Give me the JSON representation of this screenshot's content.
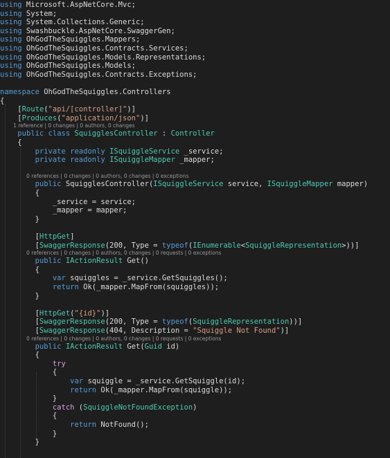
{
  "editor": {
    "theme_colors": {
      "background": "#1e1e1e",
      "text": "#dcdcdc",
      "keyword": "#569cd6",
      "type": "#4ec9b0",
      "string": "#d69d85",
      "control": "#d8a0df",
      "codelens": "#999999"
    },
    "lines": [
      {
        "kind": "code",
        "tokens": [
          {
            "t": "using",
            "c": "kw"
          },
          {
            "t": " Microsoft.AspNetCore.Mvc;",
            "c": "pl"
          }
        ]
      },
      {
        "kind": "code",
        "tokens": [
          {
            "t": "using",
            "c": "kw"
          },
          {
            "t": " System;",
            "c": "pl"
          }
        ]
      },
      {
        "kind": "code",
        "tokens": [
          {
            "t": "using",
            "c": "kw"
          },
          {
            "t": " System.Collections.Generic;",
            "c": "pl"
          }
        ]
      },
      {
        "kind": "code",
        "tokens": [
          {
            "t": "using",
            "c": "kw"
          },
          {
            "t": " Swashbuckle.AspNetCore.SwaggerGen;",
            "c": "pl"
          }
        ]
      },
      {
        "kind": "code",
        "tokens": [
          {
            "t": "using",
            "c": "kw"
          },
          {
            "t": " OhGodTheSquiggles.Mappers;",
            "c": "pl"
          }
        ]
      },
      {
        "kind": "code",
        "tokens": [
          {
            "t": "using",
            "c": "kw"
          },
          {
            "t": " OhGodTheSquiggles.Contracts.Services;",
            "c": "pl"
          }
        ]
      },
      {
        "kind": "code",
        "tokens": [
          {
            "t": "using",
            "c": "kw"
          },
          {
            "t": " OhGodTheSquiggles.Models.Representations;",
            "c": "pl"
          }
        ]
      },
      {
        "kind": "code",
        "tokens": [
          {
            "t": "using",
            "c": "kw"
          },
          {
            "t": " OhGodTheSquiggles.Models;",
            "c": "pl"
          }
        ]
      },
      {
        "kind": "code",
        "tokens": [
          {
            "t": "using",
            "c": "kw"
          },
          {
            "t": " OhGodTheSquiggles.Contracts.Exceptions;",
            "c": "pl"
          }
        ]
      },
      {
        "kind": "blank",
        "tokens": []
      },
      {
        "kind": "code",
        "tokens": [
          {
            "t": "namespace",
            "c": "kw"
          },
          {
            "t": " OhGodTheSquiggles.Controllers",
            "c": "pl"
          }
        ]
      },
      {
        "kind": "code",
        "tokens": [
          {
            "t": "{",
            "c": "pl"
          }
        ]
      },
      {
        "kind": "code",
        "tokens": [
          {
            "t": "    [",
            "c": "pl"
          },
          {
            "t": "Route",
            "c": "ty"
          },
          {
            "t": "(",
            "c": "pl"
          },
          {
            "t": "\"api/[controller]\"",
            "c": "st"
          },
          {
            "t": ")]",
            "c": "pl"
          }
        ]
      },
      {
        "kind": "code",
        "tokens": [
          {
            "t": "    [",
            "c": "pl"
          },
          {
            "t": "Produces",
            "c": "ty"
          },
          {
            "t": "(",
            "c": "pl"
          },
          {
            "t": "\"application/json\"",
            "c": "st"
          },
          {
            "t": ")]",
            "c": "pl"
          }
        ]
      },
      {
        "kind": "lens",
        "text": "        1 reference | 0 changes | 0 authors, 0 changes"
      },
      {
        "kind": "code",
        "tokens": [
          {
            "t": "    ",
            "c": "pl"
          },
          {
            "t": "public class",
            "c": "kw"
          },
          {
            "t": " ",
            "c": "pl"
          },
          {
            "t": "SquigglesController",
            "c": "ty"
          },
          {
            "t": " : ",
            "c": "pl"
          },
          {
            "t": "Controller",
            "c": "ty"
          }
        ]
      },
      {
        "kind": "code",
        "tokens": [
          {
            "t": "    {",
            "c": "pl"
          }
        ]
      },
      {
        "kind": "code",
        "tokens": [
          {
            "t": "        ",
            "c": "pl"
          },
          {
            "t": "private readonly",
            "c": "kw"
          },
          {
            "t": " ",
            "c": "pl"
          },
          {
            "t": "ISquiggleService",
            "c": "ty"
          },
          {
            "t": " _service;",
            "c": "pl"
          }
        ]
      },
      {
        "kind": "code",
        "tokens": [
          {
            "t": "        ",
            "c": "pl"
          },
          {
            "t": "private readonly",
            "c": "kw"
          },
          {
            "t": " ",
            "c": "pl"
          },
          {
            "t": "ISquiggleMapper",
            "c": "ty"
          },
          {
            "t": " _mapper;",
            "c": "pl"
          }
        ]
      },
      {
        "kind": "blank",
        "tokens": []
      },
      {
        "kind": "lens",
        "text": "                0 references | 0 changes | 0 authors, 0 changes | 0 exceptions"
      },
      {
        "kind": "code",
        "tokens": [
          {
            "t": "        ",
            "c": "pl"
          },
          {
            "t": "public",
            "c": "kw"
          },
          {
            "t": " SquigglesController(",
            "c": "pl"
          },
          {
            "t": "ISquiggleService",
            "c": "ty"
          },
          {
            "t": " service, ",
            "c": "pl"
          },
          {
            "t": "ISquiggleMapper",
            "c": "ty"
          },
          {
            "t": " mapper)",
            "c": "pl"
          }
        ]
      },
      {
        "kind": "code",
        "tokens": [
          {
            "t": "        {",
            "c": "pl"
          }
        ]
      },
      {
        "kind": "code",
        "tokens": [
          {
            "t": "            _service = service;",
            "c": "pl"
          }
        ]
      },
      {
        "kind": "code",
        "tokens": [
          {
            "t": "            _mapper = mapper;",
            "c": "pl"
          }
        ]
      },
      {
        "kind": "code",
        "tokens": [
          {
            "t": "        }",
            "c": "pl"
          }
        ]
      },
      {
        "kind": "blank",
        "tokens": []
      },
      {
        "kind": "code",
        "tokens": [
          {
            "t": "        [",
            "c": "pl"
          },
          {
            "t": "HttpGet",
            "c": "ty"
          },
          {
            "t": "]",
            "c": "pl"
          }
        ]
      },
      {
        "kind": "code",
        "tokens": [
          {
            "t": "        [",
            "c": "pl"
          },
          {
            "t": "SwaggerResponse",
            "c": "ty"
          },
          {
            "t": "(200, Type = ",
            "c": "pl"
          },
          {
            "t": "typeof",
            "c": "kw"
          },
          {
            "t": "(",
            "c": "pl"
          },
          {
            "t": "IEnumerable",
            "c": "ty"
          },
          {
            "t": "<",
            "c": "pl"
          },
          {
            "t": "SquiggleRepresentation",
            "c": "ty"
          },
          {
            "t": ">))]",
            "c": "pl"
          }
        ]
      },
      {
        "kind": "lens",
        "text": "                0 references | 0 changes | 0 authors, 0 changes | 0 requests | 0 exceptions"
      },
      {
        "kind": "code",
        "tokens": [
          {
            "t": "        ",
            "c": "pl"
          },
          {
            "t": "public",
            "c": "kw"
          },
          {
            "t": " ",
            "c": "pl"
          },
          {
            "t": "IActionResult",
            "c": "ty"
          },
          {
            "t": " Get()",
            "c": "pl"
          }
        ]
      },
      {
        "kind": "code",
        "tokens": [
          {
            "t": "        {",
            "c": "pl"
          }
        ]
      },
      {
        "kind": "code",
        "tokens": [
          {
            "t": "            ",
            "c": "pl"
          },
          {
            "t": "var",
            "c": "kw"
          },
          {
            "t": " squiggles = _service.GetSquiggles();",
            "c": "pl"
          }
        ]
      },
      {
        "kind": "code",
        "tokens": [
          {
            "t": "            ",
            "c": "pl"
          },
          {
            "t": "return",
            "c": "kw"
          },
          {
            "t": " Ok(_mapper.MapFrom(squiggles));",
            "c": "pl"
          }
        ]
      },
      {
        "kind": "code",
        "tokens": [
          {
            "t": "        }",
            "c": "pl"
          }
        ]
      },
      {
        "kind": "blank",
        "tokens": []
      },
      {
        "kind": "code",
        "tokens": [
          {
            "t": "        [",
            "c": "pl"
          },
          {
            "t": "HttpGet",
            "c": "ty"
          },
          {
            "t": "(",
            "c": "pl"
          },
          {
            "t": "\"{id}\"",
            "c": "st"
          },
          {
            "t": ")]",
            "c": "pl"
          }
        ]
      },
      {
        "kind": "code",
        "tokens": [
          {
            "t": "        [",
            "c": "pl"
          },
          {
            "t": "SwaggerResponse",
            "c": "ty"
          },
          {
            "t": "(200, Type = ",
            "c": "pl"
          },
          {
            "t": "typeof",
            "c": "kw"
          },
          {
            "t": "(",
            "c": "pl"
          },
          {
            "t": "SquiggleRepresentation",
            "c": "ty"
          },
          {
            "t": "))]",
            "c": "pl"
          }
        ]
      },
      {
        "kind": "code",
        "tokens": [
          {
            "t": "        [",
            "c": "pl"
          },
          {
            "t": "SwaggerResponse",
            "c": "ty"
          },
          {
            "t": "(404, Description = ",
            "c": "pl"
          },
          {
            "t": "\"Squiggle Not Found\"",
            "c": "st"
          },
          {
            "t": ")]",
            "c": "pl"
          }
        ]
      },
      {
        "kind": "lens",
        "text": "                0 references | 0 changes | 0 authors, 0 changes | 0 requests | 0 exceptions"
      },
      {
        "kind": "code",
        "tokens": [
          {
            "t": "        ",
            "c": "pl"
          },
          {
            "t": "public",
            "c": "kw"
          },
          {
            "t": " ",
            "c": "pl"
          },
          {
            "t": "IActionResult",
            "c": "ty"
          },
          {
            "t": " Get(",
            "c": "pl"
          },
          {
            "t": "Guid",
            "c": "ty"
          },
          {
            "t": " id)",
            "c": "pl"
          }
        ]
      },
      {
        "kind": "code",
        "tokens": [
          {
            "t": "        {",
            "c": "pl"
          }
        ]
      },
      {
        "kind": "code",
        "tokens": [
          {
            "t": "            ",
            "c": "pl"
          },
          {
            "t": "try",
            "c": "ctl"
          }
        ]
      },
      {
        "kind": "code",
        "tokens": [
          {
            "t": "            {",
            "c": "pl"
          }
        ]
      },
      {
        "kind": "code",
        "tokens": [
          {
            "t": "                ",
            "c": "pl"
          },
          {
            "t": "var",
            "c": "kw"
          },
          {
            "t": " squiggle = _service.GetSquiggle(id);",
            "c": "pl"
          }
        ]
      },
      {
        "kind": "code",
        "tokens": [
          {
            "t": "                ",
            "c": "pl"
          },
          {
            "t": "return",
            "c": "kw"
          },
          {
            "t": " Ok(_mapper.MapFrom(squiggle));",
            "c": "pl"
          }
        ]
      },
      {
        "kind": "code",
        "tokens": [
          {
            "t": "            }",
            "c": "pl"
          }
        ]
      },
      {
        "kind": "code",
        "tokens": [
          {
            "t": "            ",
            "c": "pl"
          },
          {
            "t": "catch",
            "c": "ctl"
          },
          {
            "t": " (",
            "c": "pl"
          },
          {
            "t": "SquiggleNotFoundException",
            "c": "ty"
          },
          {
            "t": ")",
            "c": "pl"
          }
        ]
      },
      {
        "kind": "code",
        "tokens": [
          {
            "t": "            {",
            "c": "pl"
          }
        ]
      },
      {
        "kind": "code",
        "tokens": [
          {
            "t": "                ",
            "c": "pl"
          },
          {
            "t": "return",
            "c": "kw"
          },
          {
            "t": " NotFound();",
            "c": "pl"
          }
        ]
      },
      {
        "kind": "code",
        "tokens": [
          {
            "t": "            }",
            "c": "pl"
          }
        ]
      },
      {
        "kind": "code",
        "tokens": [
          {
            "t": "        }",
            "c": "pl"
          }
        ]
      }
    ]
  }
}
